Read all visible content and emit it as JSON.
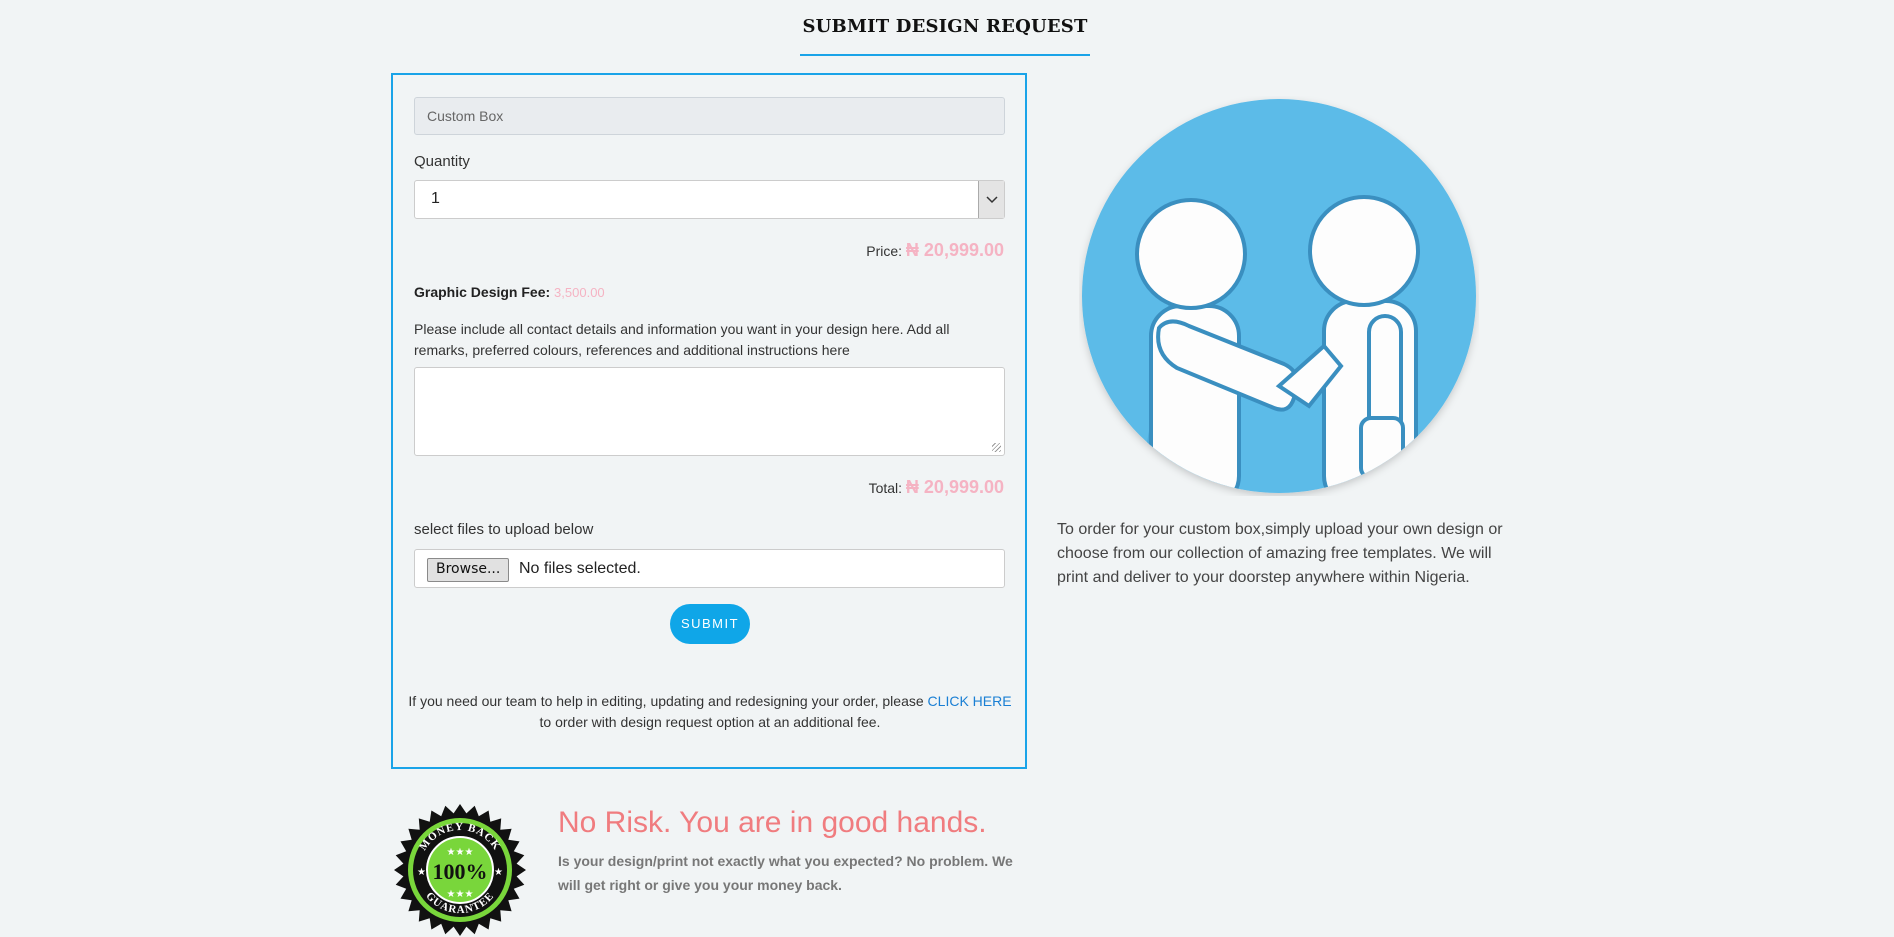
{
  "header": {
    "title": "SUBMIT DESIGN REQUEST"
  },
  "form": {
    "product_value": "Custom Box",
    "quantity_label": "Quantity",
    "quantity_value": "1",
    "price_label": "Price:",
    "price_value": "₦ 20,999.00",
    "fee_label": "Graphic Design Fee:",
    "fee_value": "3,500.00",
    "instructions": "Please include all contact details and information you want in your design here. Add all remarks, preferred colours, references and additional instructions here",
    "notes_value": "",
    "total_label": "Total:",
    "total_value": "₦ 20,999.00",
    "upload_label": "select files to upload below",
    "browse_label": "Browse...",
    "file_status": "No files selected.",
    "submit_label": "SUBMIT",
    "help_text_before": "If you need our team to help in editing, updating and redesigning your order, please",
    "help_link": "CLICK HERE",
    "help_text_after": "to order with design request option at an additional fee."
  },
  "side": {
    "description": "To order for your custom box,simply upload your own design or choose from our collection of amazing free templates. We will print and deliver to your doorstep anywhere within Nigeria."
  },
  "guarantee": {
    "badge_text": "MONEY BACK 100% GUARANTEE",
    "title": "No Risk. You are in good hands.",
    "text": "Is your design/print not exactly what you expected? No problem. We will get right or give you your money back."
  },
  "colors": {
    "accent": "#1aa3e8",
    "price_pink": "#f5b3c3",
    "risk_red": "#f07c7f",
    "submit_blue": "#0fa6e8",
    "illus_blue": "#5bbbe8"
  },
  "icons": [
    "chevron-down-icon",
    "handshake-illustration",
    "money-back-badge-icon",
    "resize-grip-icon"
  ]
}
